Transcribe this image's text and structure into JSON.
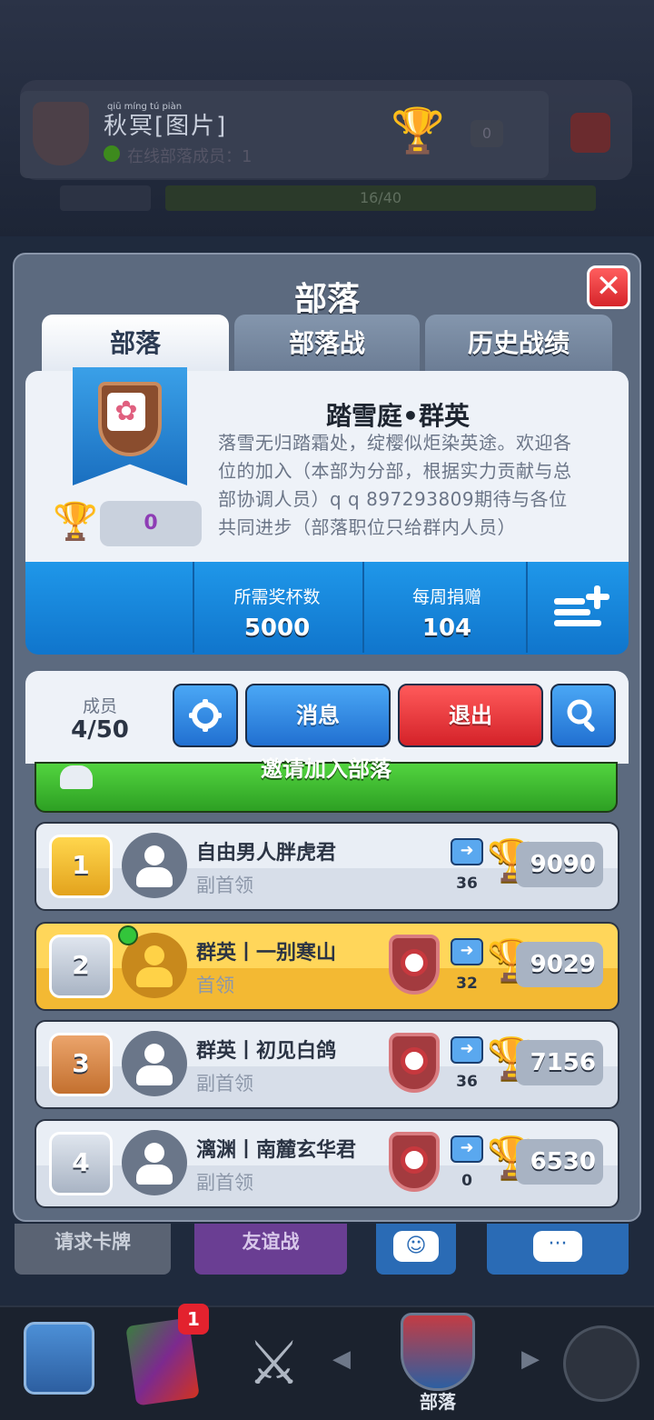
{
  "background": {
    "player_name": "秋冥[图片]",
    "player_name_ruby": "qiū míng tú piàn",
    "online_label": "在线部落成员：1",
    "trophy_value": "0",
    "progress_left": "16/40"
  },
  "panel": {
    "title": "部落",
    "close_symbol": "✕",
    "tabs": [
      "部落",
      "部落战",
      "历史战绩"
    ]
  },
  "clan": {
    "name": "踏雪庭•群英",
    "description": "落雪无归踏霜处，绽樱似炬染英途。欢迎各位的加入（本部为分部，根据实力贡献与总部协调人员）q q 897293809期待与各位共同进步（部落职位只给群内人员）",
    "trophies": "0",
    "stats": [
      {
        "label": "所需奖杯数",
        "value": "5000"
      },
      {
        "label": "每周捐赠",
        "value": "104"
      }
    ]
  },
  "toolbar": {
    "members_label": "成员",
    "members_count": "4/50",
    "message_label": "消息",
    "exit_label": "退出",
    "invite_label": "邀请加入部落"
  },
  "members": [
    {
      "rank": "1",
      "name": "自由男人胖虎君",
      "role": "副首领",
      "donations": "36",
      "trophies": "9090",
      "war": false,
      "online": false,
      "me": false,
      "rank_style": "gold"
    },
    {
      "rank": "2",
      "name": "群英丨一别寒山",
      "role": "首领",
      "donations": "32",
      "trophies": "9029",
      "war": true,
      "online": true,
      "me": true,
      "rank_style": "silver"
    },
    {
      "rank": "3",
      "name": "群英丨初见白鸽",
      "role": "副首领",
      "donations": "36",
      "trophies": "7156",
      "war": true,
      "online": false,
      "me": false,
      "rank_style": "bronze"
    },
    {
      "rank": "4",
      "name": "漓渊丨南麓玄华君",
      "role": "副首领",
      "donations": "0",
      "trophies": "6530",
      "war": true,
      "online": false,
      "me": false,
      "rank_style": "silver"
    }
  ],
  "bottom_buttons": {
    "request_cards": "请求卡牌",
    "friendly_battle": "友谊战"
  },
  "nav": {
    "clan_label": "部落",
    "cards_badge": "1"
  },
  "colors": {
    "panel": "#5c6a7f",
    "stats_blue": "#1f97e9",
    "exit_red": "#d42229",
    "invite_green": "#2da023",
    "highlight_gold": "#ffd65a"
  }
}
